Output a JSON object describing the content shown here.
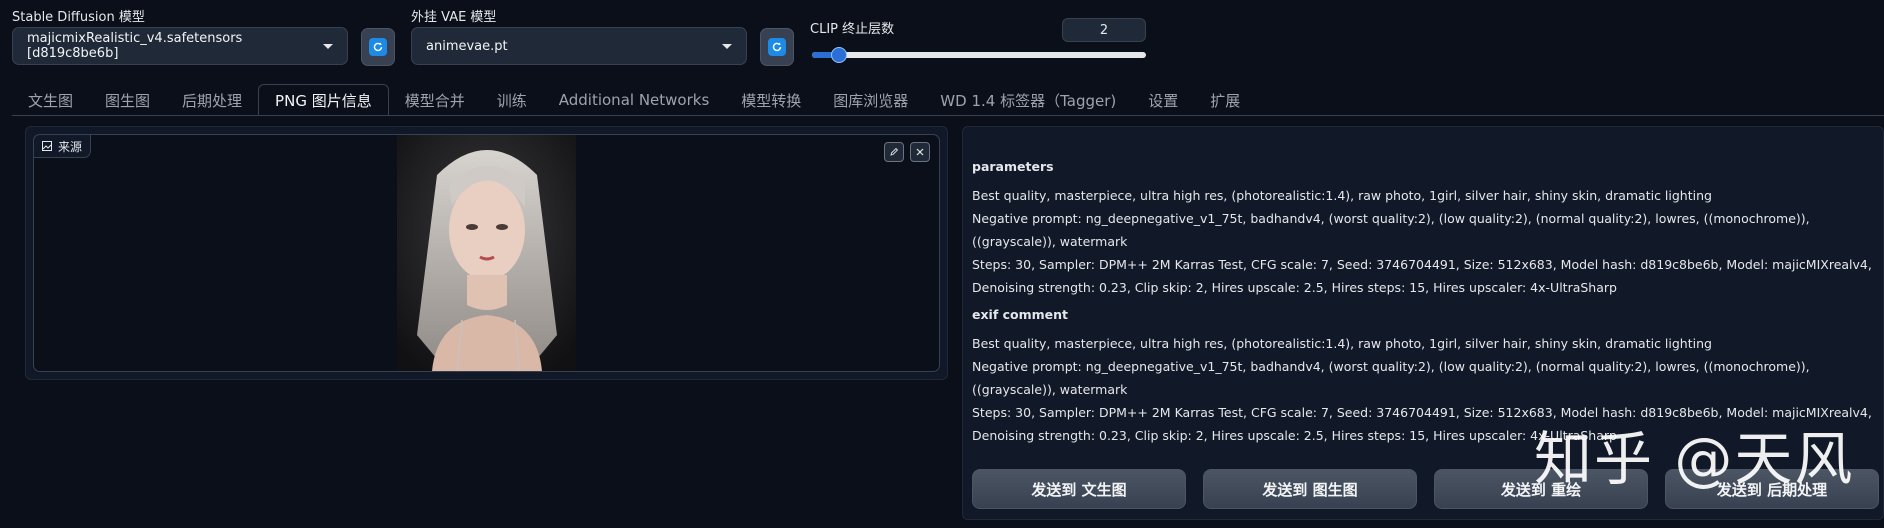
{
  "header": {
    "sd_model_label": "Stable Diffusion 模型",
    "sd_model_value": "majicmixRealistic_v4.safetensors [d819c8be6b]",
    "vae_label": "外挂 VAE 模型",
    "vae_value": "animevae.pt",
    "clip_label": "CLIP 终止层数",
    "clip_value": "2",
    "clip_fraction": 0.08
  },
  "tabs": [
    {
      "label": "文生图"
    },
    {
      "label": "图生图"
    },
    {
      "label": "后期处理"
    },
    {
      "label": "PNG 图片信息",
      "active": true
    },
    {
      "label": "模型合并"
    },
    {
      "label": "训练"
    },
    {
      "label": "Additional Networks"
    },
    {
      "label": "模型转换"
    },
    {
      "label": "图库浏览器"
    },
    {
      "label": "WD 1.4 标签器（Tagger)"
    },
    {
      "label": "设置"
    },
    {
      "label": "扩展"
    }
  ],
  "source": {
    "badge_label": "来源",
    "image_icon": "image-icon",
    "edit_icon": "pencil-icon",
    "close_icon": "close-icon"
  },
  "info": {
    "params_head": "parameters",
    "params_prompt": "Best quality, masterpiece, ultra high res, (photorealistic:1.4), raw photo, 1girl, silver hair, shiny skin, dramatic lighting",
    "params_negative": "Negative prompt: ng_deepnegative_v1_75t, badhandv4, (worst quality:2), (low quality:2), (normal quality:2), lowres, ((monochrome)), ((grayscale)), watermark",
    "params_steps": "Steps: 30, Sampler: DPM++ 2M Karras Test, CFG scale: 7, Seed: 3746704491, Size: 512x683, Model hash: d819c8be6b, Model: majicMIXrealv4, Denoising strength: 0.23, Clip skip: 2, Hires upscale: 2.5, Hires steps: 15, Hires upscaler: 4x-UltraSharp",
    "exif_head": "exif comment",
    "exif_prompt": "Best quality, masterpiece, ultra high res, (photorealistic:1.4), raw photo, 1girl, silver hair, shiny skin, dramatic lighting",
    "exif_negative": "Negative prompt: ng_deepnegative_v1_75t, badhandv4, (worst quality:2), (low quality:2), (normal quality:2), lowres, ((monochrome)), ((grayscale)), watermark",
    "exif_steps": "Steps: 30, Sampler: DPM++ 2M Karras Test, CFG scale: 7, Seed: 3746704491, Size: 512x683, Model hash: d819c8be6b, Model: majicMIXrealv4, Denoising strength: 0.23, Clip skip: 2, Hires upscale: 2.5, Hires steps: 15, Hires upscaler: 4x-UltraSharp"
  },
  "buttons": {
    "send_txt2img": "发送到 文生图",
    "send_img2img": "发送到 图生图",
    "send_inpaint": "发送到 重绘",
    "send_extras": "发送到 后期处理"
  },
  "watermark": "知乎 @天风",
  "colors": {
    "accent": "#2b6fd6",
    "refresh_icon": "#1d8be6",
    "background": "#0b0f19"
  }
}
